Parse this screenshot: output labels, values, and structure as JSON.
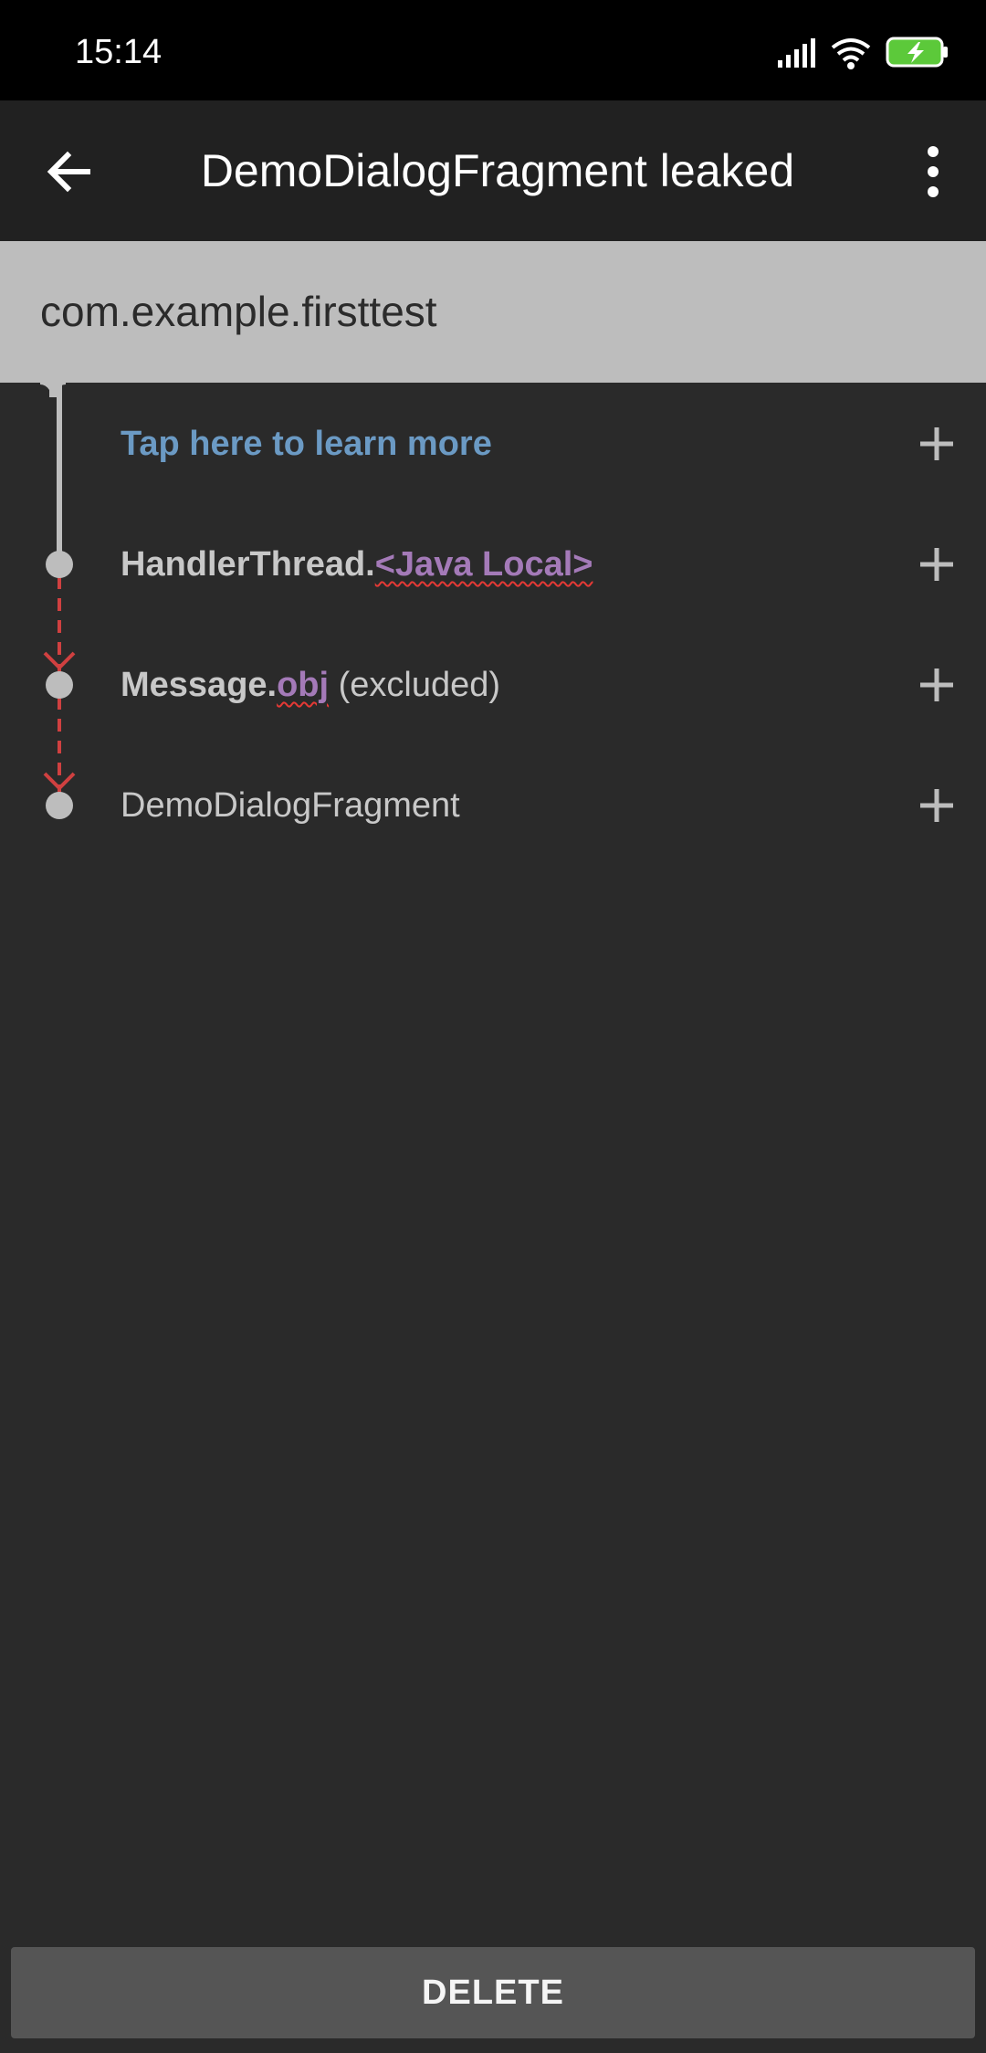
{
  "status_bar": {
    "time": "15:14",
    "icons": [
      "signal-icon",
      "wifi-icon",
      "battery-charging-icon"
    ]
  },
  "app_bar": {
    "title": "DemoDialogFragment leaked",
    "back_icon": "arrow-left-icon",
    "menu_icon": "more-vert-icon"
  },
  "header": {
    "package": "com.example.firsttest"
  },
  "trace": {
    "learn_more": "Tap here to learn more",
    "rows": [
      {
        "class": "HandlerThread.",
        "ref": "<Java Local>",
        "suffix": ""
      },
      {
        "class": "Message.",
        "ref": "obj",
        "suffix": " (excluded)"
      },
      {
        "class": "DemoDialogFragment",
        "ref": "",
        "suffix": ""
      }
    ],
    "expand_icon": "plus-icon"
  },
  "footer": {
    "delete_label": "DELETE"
  },
  "colors": {
    "link": "#6b9ac4",
    "reference": "#a47ab8",
    "leak_line": "#d04040",
    "header": "#bdbdbd",
    "background": "#2a2a2a"
  }
}
